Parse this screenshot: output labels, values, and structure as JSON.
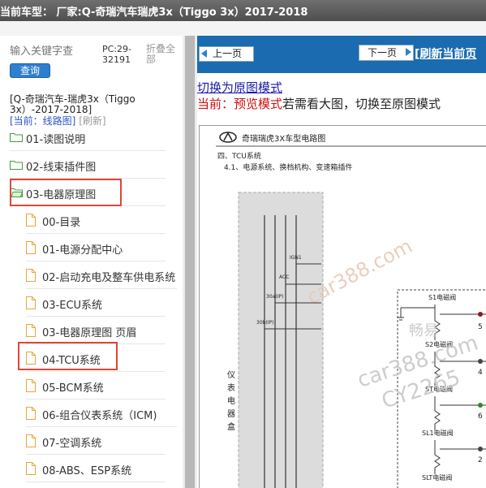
{
  "topbar": {
    "title": "当前车型： 厂家:Q-奇瑞汽车瑞虎3x（Tiggo 3x）2017-2018"
  },
  "sidebar": {
    "search_placeholder": "输入关键字查",
    "query_label": "查询",
    "pc_label": "PC:29-32191",
    "fold_label": "折叠全部",
    "car_name": "[Q-奇瑞汽车-瑞虎3x（Tiggo 3x）-2017-2018]",
    "current_prefix": "[当前：线路图]",
    "refresh_label": "[刷新]",
    "items": [
      {
        "label": "01-读图说明",
        "type": "folder"
      },
      {
        "label": "02-线束插件图",
        "type": "folder"
      },
      {
        "label": "03-电器原理图",
        "type": "folder-open"
      },
      {
        "label": "00-目录",
        "type": "file"
      },
      {
        "label": "01-电源分配中心",
        "type": "file"
      },
      {
        "label": "02-启动充电及整车供电系统",
        "type": "file"
      },
      {
        "label": "03-ECU系统",
        "type": "file"
      },
      {
        "label": "03-电器原理图 页眉",
        "type": "file"
      },
      {
        "label": "04-TCU系统",
        "type": "file"
      },
      {
        "label": "05-BCM系统",
        "type": "file"
      },
      {
        "label": "06-组合仪表系统（ICM)",
        "type": "file"
      },
      {
        "label": "07-空调系统",
        "type": "file"
      },
      {
        "label": "08-ABS、ESP系统",
        "type": "file"
      }
    ]
  },
  "content": {
    "prev_label": "上一页",
    "next_label": "下一页",
    "refresh_page_label": "[刷新当前页",
    "switch_label": "切换为原图模式",
    "current_label": "当前：",
    "preview_mode": "预览模式",
    "hint": "若需看大图，切换至原图模式"
  },
  "diagram": {
    "header": "奇瑞瑞虎3X车型电路图",
    "section": "四、TCU系统",
    "subsection": "4.1、电源系统、换档机构、变速箱插件",
    "box_label": [
      "仪",
      "表",
      "电",
      "器",
      "盒"
    ],
    "wire_labels": [
      "IGN1",
      "ACC",
      "30a(IP)",
      "30b(IP)"
    ],
    "valves": [
      "S1电磁阀",
      "S2电磁阀",
      "ST电磁阀",
      "SL1电磁阀",
      "SLT电磁阀"
    ],
    "pins": [
      "5",
      "4",
      "6",
      "2"
    ],
    "watermarks": [
      "car388.com",
      "畅易",
      "car388.com",
      "CY2265"
    ]
  },
  "colors": {
    "accent": "#1a6bb0",
    "highlight": "#e0453a",
    "link_red": "#cc1111"
  }
}
